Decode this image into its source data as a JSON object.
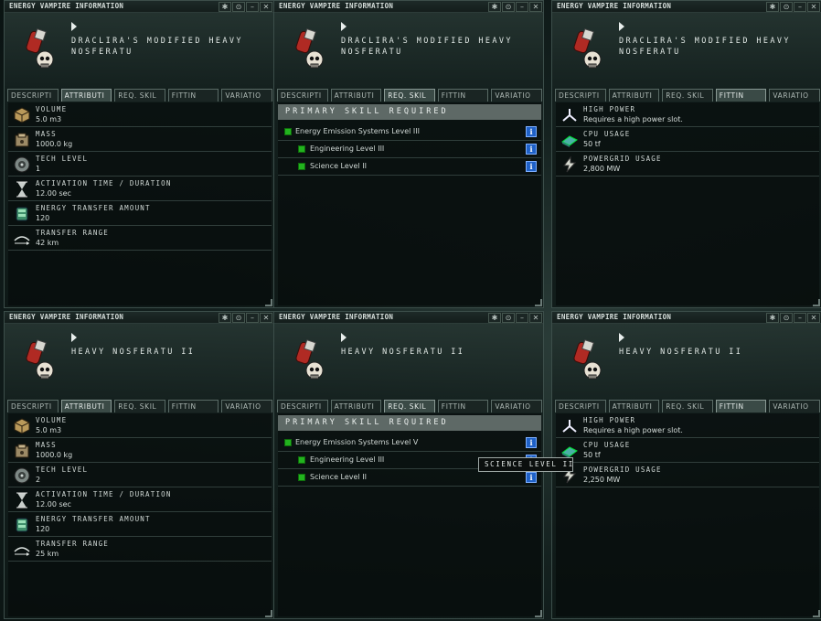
{
  "window_title": "ENERGY VAMPIRE INFORMATION",
  "window_buttons": [
    "✱",
    "⊙",
    "–",
    "✕"
  ],
  "tabs": [
    "DESCRIPTI",
    "ATTRIBUTI",
    "REQ. SKIL",
    "FITTIN",
    "VARIATIO"
  ],
  "panels": [
    {
      "item_name": "DRACLIRA'S MODIFIED HEAVY NOSFERATU",
      "active_tab": 1,
      "view": "attributes",
      "attributes": [
        {
          "icon": "cube-icon",
          "label": "VOLUME",
          "value": "5.0 m3"
        },
        {
          "icon": "crate-icon",
          "label": "MASS",
          "value": "1000.0 kg"
        },
        {
          "icon": "tech-disc-icon",
          "label": "TECH LEVEL",
          "value": "1"
        },
        {
          "icon": "hourglass-icon",
          "label": "ACTIVATION TIME / DURATION",
          "value": "12.00 sec"
        },
        {
          "icon": "energy-cell-icon",
          "label": "ENERGY TRANSFER AMOUNT",
          "value": "120"
        },
        {
          "icon": "range-icon",
          "label": "TRANSFER RANGE",
          "value": "42 km"
        }
      ]
    },
    {
      "item_name": "DRACLIRA'S MODIFIED HEAVY NOSFERATU",
      "active_tab": 2,
      "view": "skills",
      "skills_header": "PRIMARY SKILL REQUIRED",
      "skills": [
        {
          "name": "Energy Emission Systems Level III",
          "indent": 0
        },
        {
          "name": "Engineering Level III",
          "indent": 1
        },
        {
          "name": "Science Level II",
          "indent": 1
        }
      ]
    },
    {
      "item_name": "DRACLIRA'S MODIFIED HEAVY NOSFERATU",
      "active_tab": 3,
      "view": "fitting",
      "fitting": [
        {
          "icon": "high-power-icon",
          "label": "HIGH POWER",
          "value": "Requires a high power slot."
        },
        {
          "icon": "cpu-icon",
          "label": "CPU USAGE",
          "value": "50 tf"
        },
        {
          "icon": "powergrid-icon",
          "label": "POWERGRID USAGE",
          "value": "2,800 MW"
        }
      ]
    },
    {
      "item_name": "HEAVY NOSFERATU II",
      "active_tab": 1,
      "view": "attributes",
      "attributes": [
        {
          "icon": "cube-icon",
          "label": "VOLUME",
          "value": "5.0 m3"
        },
        {
          "icon": "crate-icon",
          "label": "MASS",
          "value": "1000.0 kg"
        },
        {
          "icon": "tech-disc-icon",
          "label": "TECH LEVEL",
          "value": "2"
        },
        {
          "icon": "hourglass-icon",
          "label": "ACTIVATION TIME / DURATION",
          "value": "12.00 sec"
        },
        {
          "icon": "energy-cell-icon",
          "label": "ENERGY TRANSFER AMOUNT",
          "value": "120"
        },
        {
          "icon": "range-icon",
          "label": "TRANSFER RANGE",
          "value": "25 km"
        }
      ]
    },
    {
      "item_name": "HEAVY NOSFERATU II",
      "active_tab": 2,
      "view": "skills",
      "skills_header": "PRIMARY SKILL REQUIRED",
      "skills": [
        {
          "name": "Energy Emission Systems Level V",
          "indent": 0
        },
        {
          "name": "Engineering Level III",
          "indent": 1
        },
        {
          "name": "Science Level II",
          "indent": 1
        }
      ]
    },
    {
      "item_name": "HEAVY NOSFERATU II",
      "active_tab": 3,
      "view": "fitting",
      "fitting": [
        {
          "icon": "high-power-icon",
          "label": "HIGH POWER",
          "value": "Requires a high power slot."
        },
        {
          "icon": "cpu-icon",
          "label": "CPU USAGE",
          "value": "50 tf"
        },
        {
          "icon": "powergrid-icon",
          "label": "POWERGRID USAGE",
          "value": "2,250 MW"
        }
      ]
    }
  ],
  "tooltip": "SCIENCE LEVEL II",
  "colors": {
    "skill_indicator": "#22b31e",
    "info_button": "#1f61c7",
    "tab_active": "#3a4a46"
  }
}
